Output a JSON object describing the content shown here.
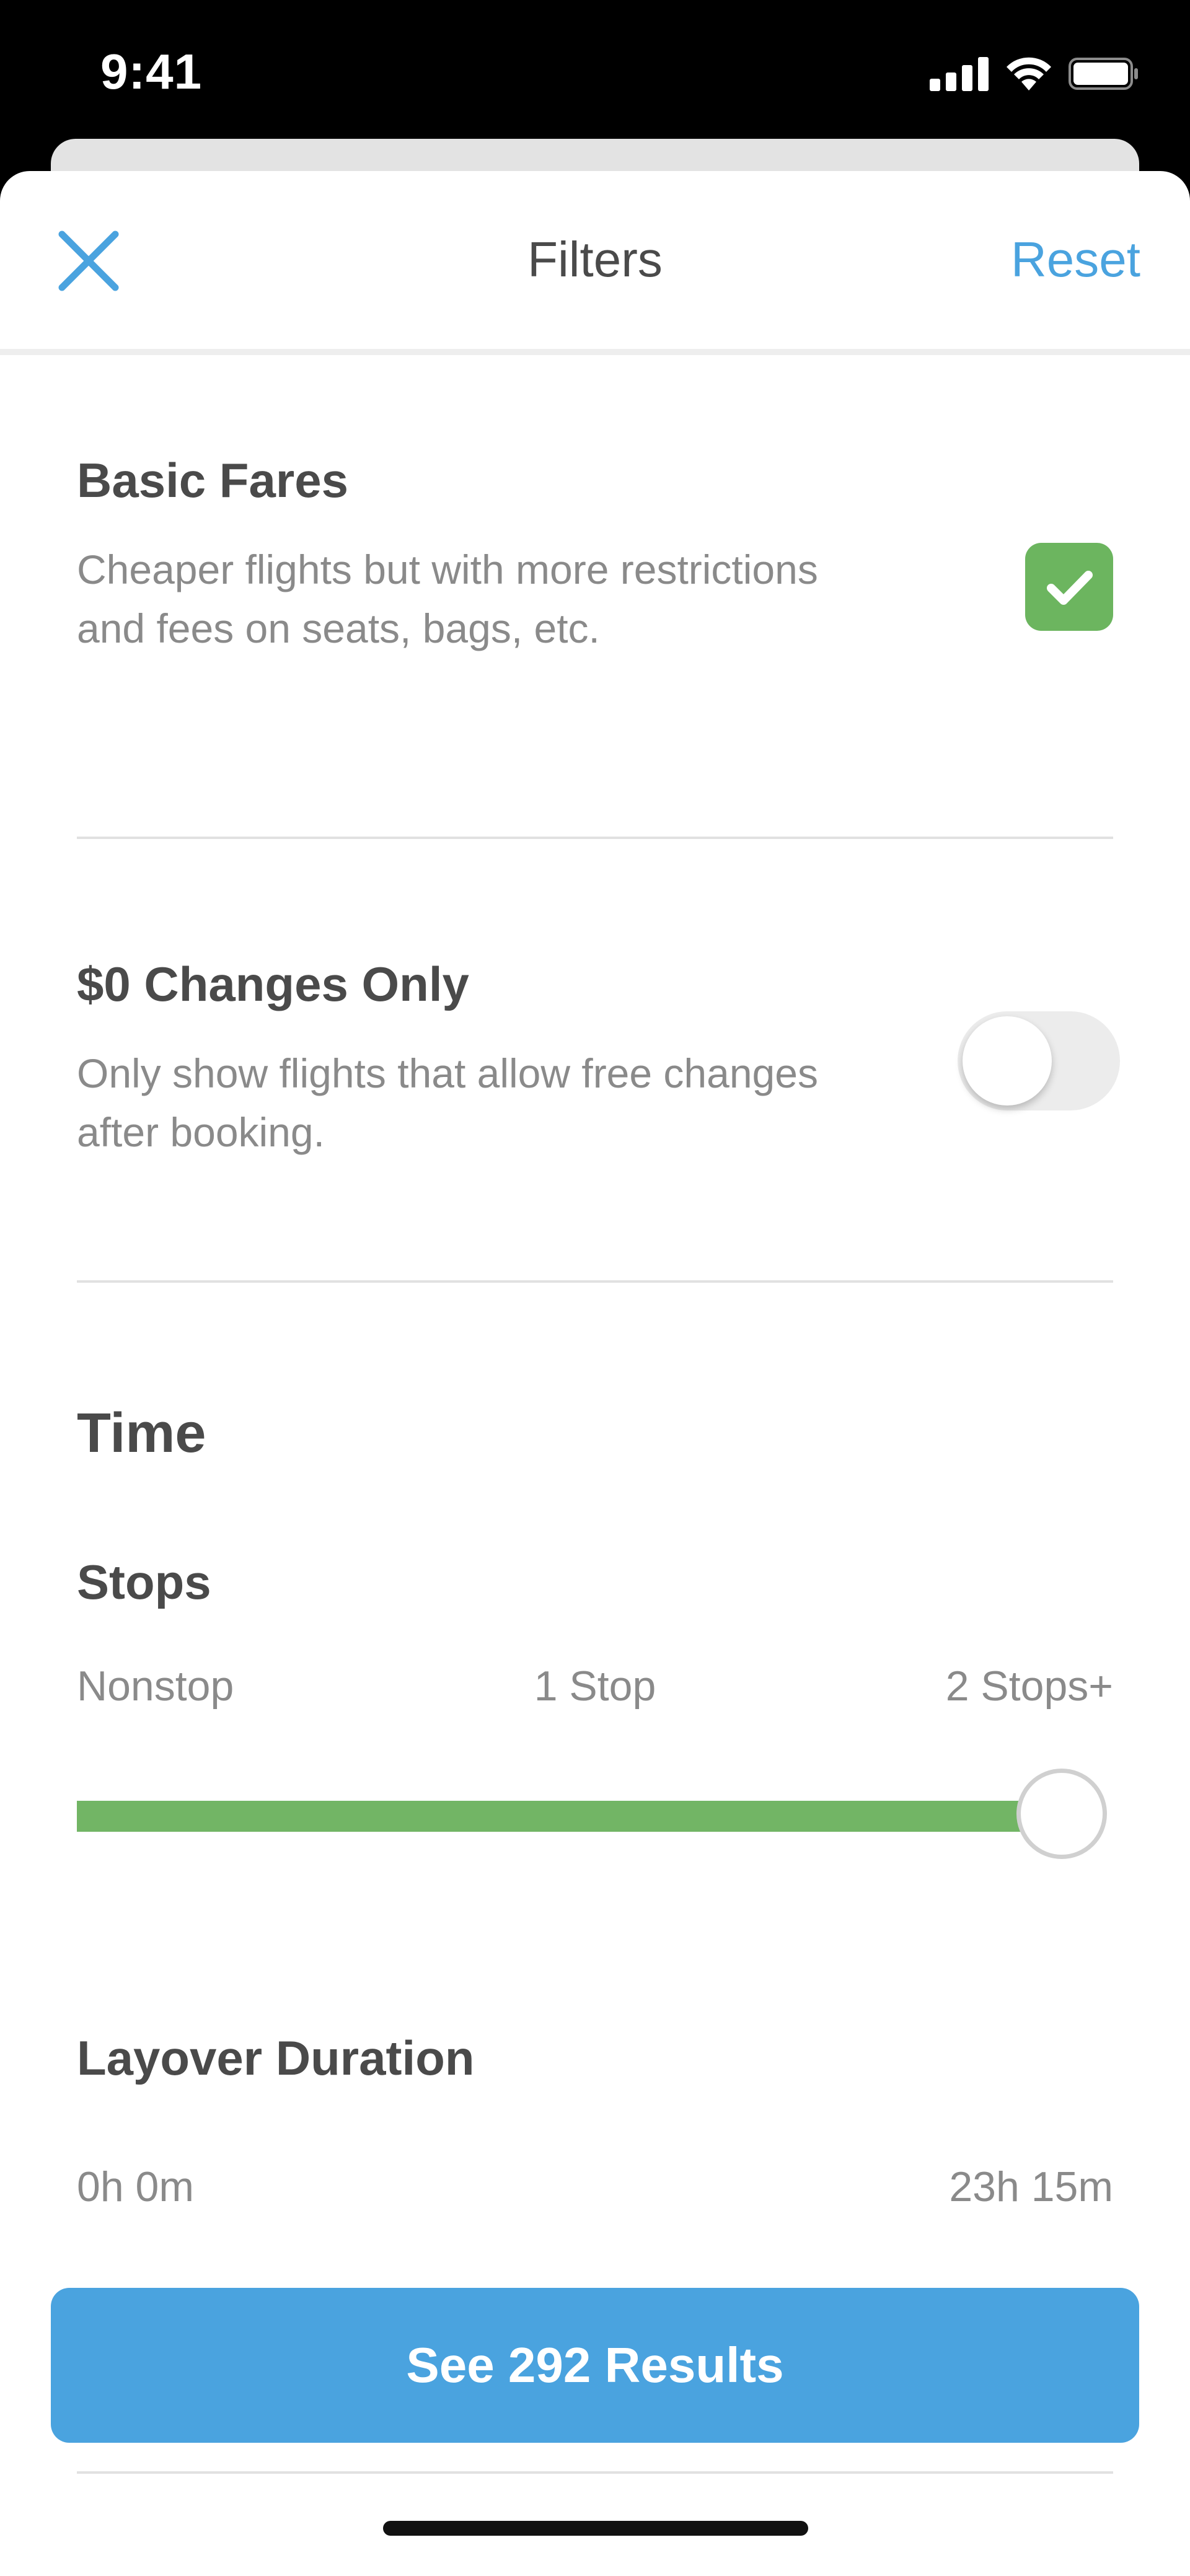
{
  "status_bar": {
    "time": "9:41"
  },
  "header": {
    "title": "Filters",
    "reset_label": "Reset",
    "close_icon": "close-icon"
  },
  "basic_fares": {
    "title": "Basic Fares",
    "description": "Cheaper flights but with more restrictions and fees on seats, bags, etc.",
    "checked": true
  },
  "zero_changes": {
    "title": "$0 Changes Only",
    "description": "Only show flights that allow free changes after booking.",
    "enabled": false
  },
  "time_section": {
    "title": "Time"
  },
  "stops": {
    "title": "Stops",
    "labels": [
      "Nonstop",
      "1 Stop",
      "2 Stops+"
    ],
    "selected": "2 Stops+"
  },
  "layover": {
    "title": "Layover Duration",
    "min_label": "0h 0m",
    "max_label": "23h 15m"
  },
  "results_button": {
    "label": "See 292 Results"
  },
  "colors": {
    "accent": "#4aa3df",
    "success": "#6cb55f",
    "text": "#4a4a4a",
    "muted": "#8a8a8a"
  }
}
